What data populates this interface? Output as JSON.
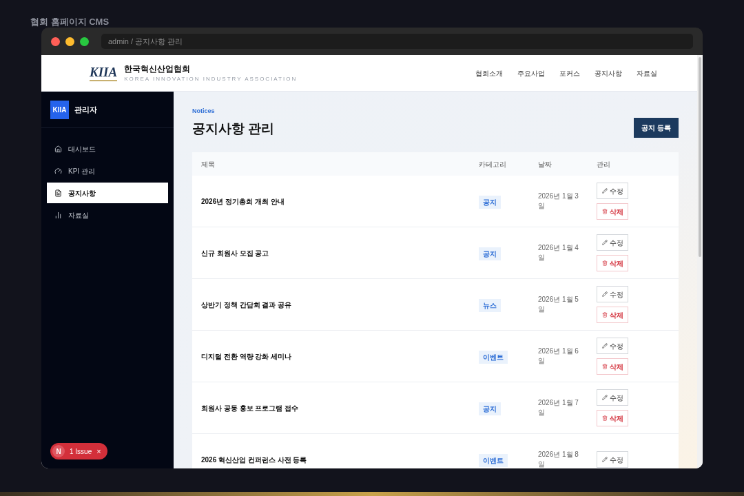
{
  "app_title": "협회 홈페이지 CMS",
  "window": {
    "address": "admin / 공지사항 관리"
  },
  "site_header": {
    "logo": "KIIA",
    "name": "한국혁신산업협회",
    "tagline": "KOREA INNOVATION INDUSTRY ASSOCIATION",
    "nav": [
      "협회소개",
      "주요사업",
      "포커스",
      "공지사항",
      "자료실"
    ]
  },
  "sidebar": {
    "badge": "KIIA",
    "title": "관리자",
    "items": [
      {
        "label": "대시보드",
        "selected": false
      },
      {
        "label": "KPI 관리",
        "selected": false
      },
      {
        "label": "공지사항",
        "selected": true
      },
      {
        "label": "자료실",
        "selected": false
      }
    ]
  },
  "issue_badge": {
    "letter": "N",
    "label": "1 Issue",
    "close": "×"
  },
  "page": {
    "eyebrow": "Notices",
    "title": "공지사항 관리",
    "action": "공지 등록"
  },
  "table": {
    "columns": [
      "제목",
      "카테고리",
      "날짜",
      "관리"
    ],
    "rows": [
      {
        "title": "2026년 정기총회 개최 안내",
        "category": "공지",
        "date": "2026년 1월 3일",
        "edit": "수정",
        "delete": "삭제"
      },
      {
        "title": "신규 회원사 모집 공고",
        "category": "공지",
        "date": "2026년 1월 4일",
        "edit": "수정",
        "delete": "삭제"
      },
      {
        "title": "상반기 정책 간담회 결과 공유",
        "category": "뉴스",
        "date": "2026년 1월 5일",
        "edit": "수정",
        "delete": "삭제"
      },
      {
        "title": "디지털 전환 역량 강화 세미나",
        "category": "이벤트",
        "date": "2026년 1월 6일",
        "edit": "수정",
        "delete": "삭제"
      },
      {
        "title": "회원사 공동 홍보 프로그램 접수",
        "category": "공지",
        "date": "2026년 1월 7일",
        "edit": "수정",
        "delete": "삭제"
      },
      {
        "title": "2026 혁신산업 컨퍼런스 사전 등록",
        "category": "이벤트",
        "date": "2026년 1월 8일",
        "edit": "수정"
      }
    ]
  }
}
